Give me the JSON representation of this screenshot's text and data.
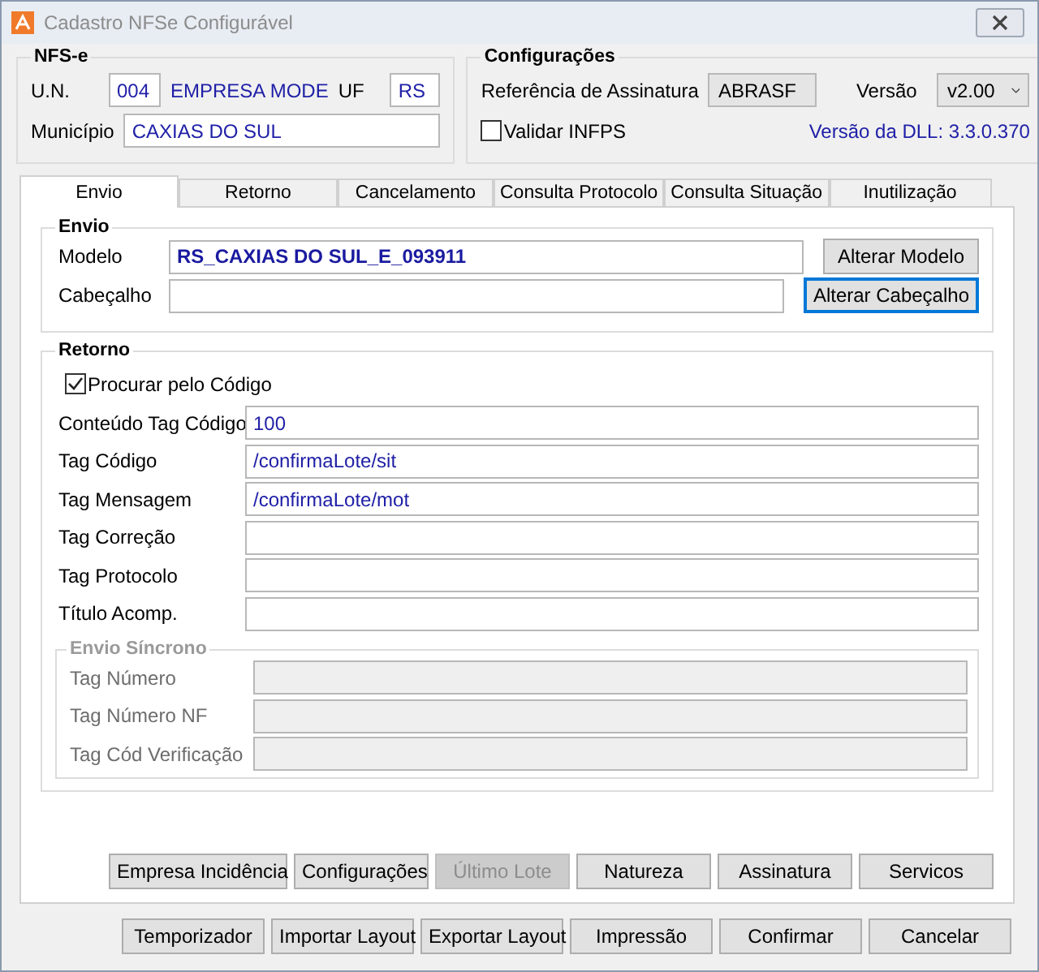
{
  "window": {
    "title": "Cadastro NFSe Configurável"
  },
  "nfse": {
    "title": "NFS-e",
    "un_label": "U.N.",
    "un_value": "004",
    "company": "EMPRESA MODE",
    "uf_label": "UF",
    "uf_value": "RS",
    "municipio_label": "Município",
    "municipio_value": "CAXIAS DO SUL"
  },
  "config": {
    "title": "Configurações",
    "signature_label": "Referência de Assinatura",
    "signature_value": "ABRASF",
    "version_label": "Versão",
    "version_value": "v2.00",
    "validate": {
      "label": "Validar INFPS",
      "checked": false
    },
    "dll_version": "Versão da DLL: 3.3.0.370"
  },
  "tabs": [
    {
      "label": "Envio",
      "selected": true
    },
    {
      "label": "Retorno",
      "selected": false
    },
    {
      "label": "Cancelamento",
      "selected": false
    },
    {
      "label": "Consulta Protocolo",
      "selected": false
    },
    {
      "label": "Consulta Situação",
      "selected": false
    },
    {
      "label": "Inutilização",
      "selected": false
    }
  ],
  "envio": {
    "title": "Envio",
    "fields": [
      {
        "label": "Modelo",
        "value": "RS_CAXIAS DO SUL_E_093911",
        "button": {
          "label": "Alterar Modelo",
          "focused": false
        }
      },
      {
        "label": "Cabeçalho",
        "button": {
          "label": "Alterar Cabeçalho",
          "focused": true
        }
      }
    ]
  },
  "retorno": {
    "title": "Retorno",
    "search_by_code": {
      "label": "Procurar pelo Código",
      "checked": true
    },
    "fields": [
      {
        "label": "Conteúdo Tag Código",
        "value": "100"
      },
      {
        "label": "Tag Código",
        "value": "/confirmaLote/sit"
      },
      {
        "label": "Tag Mensagem",
        "value": "/confirmaLote/mot"
      },
      {
        "label": "Tag Correção"
      },
      {
        "label": "Tag Protocolo"
      },
      {
        "label": "Título Acomp."
      }
    ],
    "sync": {
      "title": "Envio Síncrono",
      "disabled": true,
      "fields": [
        {
          "label": "Tag Número"
        },
        {
          "label": "Tag Número NF"
        },
        {
          "label": "Tag Cód Verificação"
        }
      ]
    }
  },
  "action_buttons": [
    {
      "label": "Empresa Incidência",
      "disabled": false
    },
    {
      "label": "Configurações",
      "disabled": false
    },
    {
      "label": "Último Lote",
      "disabled": true
    },
    {
      "label": "Natureza",
      "disabled": false
    },
    {
      "label": "Assinatura",
      "disabled": false
    },
    {
      "label": "Servicos",
      "disabled": false
    }
  ],
  "footer_buttons": [
    {
      "label": "Temporizador"
    },
    {
      "label": "Importar Layout"
    },
    {
      "label": "Exportar Layout"
    },
    {
      "label": "Impressão"
    },
    {
      "label": "Confirmar"
    },
    {
      "label": "Cancelar"
    }
  ]
}
